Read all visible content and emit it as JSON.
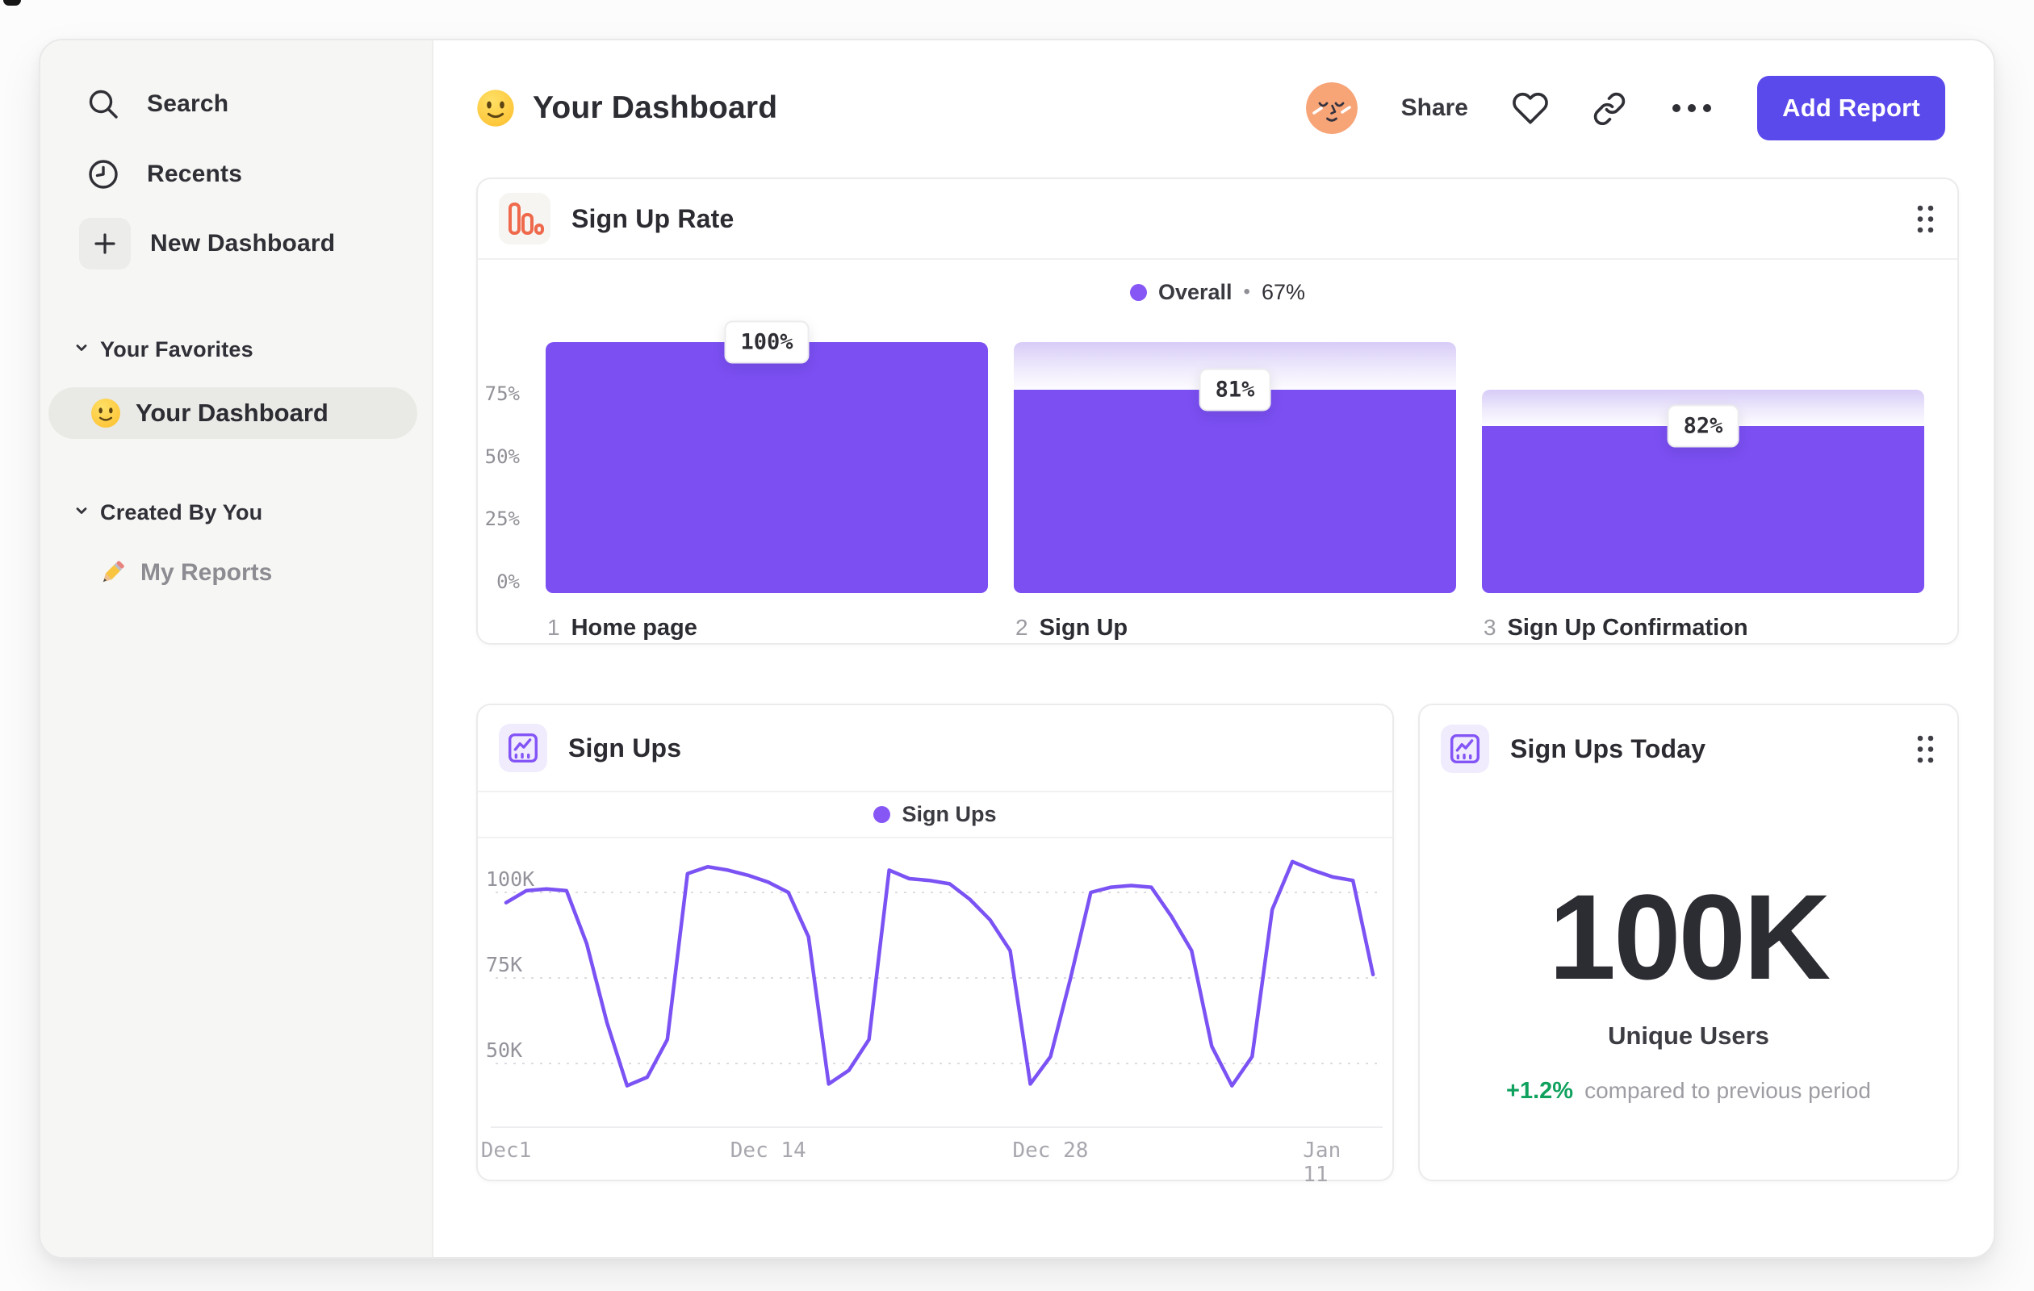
{
  "header": {
    "title": "Your Dashboard",
    "title_icon": "smiley-emoji",
    "share_label": "Share",
    "add_report_label": "Add Report"
  },
  "sidebar": {
    "nav": [
      {
        "label": "Search",
        "icon": "search-icon"
      },
      {
        "label": "Recents",
        "icon": "clock-icon"
      },
      {
        "label": "New Dashboard",
        "icon": "plus-icon"
      }
    ],
    "sections": [
      {
        "label": "Your Favorites",
        "items": [
          {
            "label": "Your Dashboard",
            "icon": "smiley-emoji",
            "selected": true
          }
        ]
      },
      {
        "label": "Created By You",
        "items": [
          {
            "label": "My Reports",
            "icon": "pencil-emoji",
            "selected": false
          }
        ]
      }
    ]
  },
  "colors": {
    "accent_purple": "#7b4ff2",
    "legend_purple": "#8757f5",
    "button_indigo": "#5a49eb",
    "icon_orange": "#ef6a4c",
    "avatar_peach": "#f7a477",
    "delta_green": "#10a15e"
  },
  "chart_data": [
    {
      "id": "signup_rate",
      "type": "bar",
      "subtype": "funnel",
      "title": "Sign Up Rate",
      "legend": {
        "series": "Overall",
        "separator": "•",
        "value": "67%",
        "position": "top-center"
      },
      "categories": [
        "Home page",
        "Sign Up",
        "Sign Up Confirmation"
      ],
      "step_numbers": [
        "1",
        "2",
        "3"
      ],
      "values_pct_of_previous": [
        100,
        81,
        82
      ],
      "values_pct_cumulative": [
        100,
        81,
        66.4
      ],
      "bar_labels": [
        "100%",
        "81%",
        "82%"
      ],
      "yticks": [
        "75%",
        "50%",
        "25%",
        "0%"
      ],
      "ytick_values": [
        75,
        50,
        25,
        0
      ],
      "ylim": [
        0,
        100
      ],
      "grid": false
    },
    {
      "id": "sign_ups",
      "type": "line",
      "title": "Sign Ups",
      "legend": {
        "series": "Sign Ups",
        "position": "top-center"
      },
      "x_unit": "day (Dec 1 = 0)",
      "xticks": [
        {
          "label": "Dec1",
          "day": 0
        },
        {
          "label": "Dec 14",
          "day": 13
        },
        {
          "label": "Dec 28",
          "day": 27
        },
        {
          "label": "Jan 11",
          "day": 41
        }
      ],
      "yticks": [
        {
          "label": "100K",
          "value": 100
        },
        {
          "label": "75K",
          "value": 75
        },
        {
          "label": "50K",
          "value": 50
        }
      ],
      "unit": "thousands of sign ups",
      "values_thousands": [
        97,
        100.5,
        101,
        100.5,
        85,
        62,
        43.5,
        46,
        57,
        105.5,
        107.5,
        106.5,
        105,
        103,
        100,
        87,
        44,
        48,
        57,
        106.5,
        104,
        103.5,
        102.5,
        98,
        92,
        83,
        44,
        52,
        75,
        100,
        101.5,
        102,
        101.5,
        93,
        83,
        55,
        43.5,
        52,
        95,
        109,
        106.5,
        104.5,
        103.5,
        76
      ],
      "ylim": [
        30,
        115
      ],
      "grid": "dashed-horizontal"
    },
    {
      "id": "sign_ups_today",
      "type": "big-number",
      "title": "Sign Ups Today",
      "value": "100K",
      "label": "Unique Users",
      "delta": "+1.2%",
      "delta_note": "compared to previous period"
    }
  ]
}
